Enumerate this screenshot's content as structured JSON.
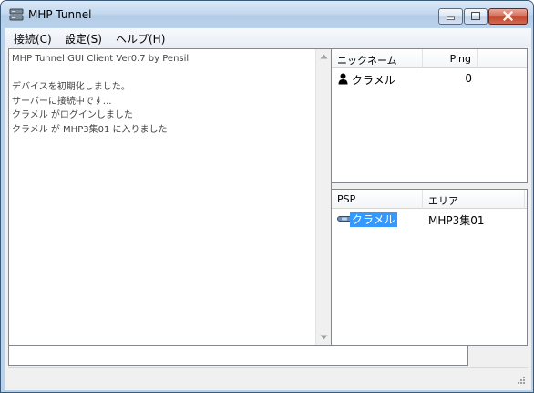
{
  "window": {
    "title": "MHP Tunnel",
    "icons": [
      "app-icon",
      "minimize-icon",
      "maximize-icon",
      "close-icon"
    ]
  },
  "menu": {
    "items": [
      "接続(C)",
      "設定(S)",
      "ヘルプ(H)"
    ]
  },
  "log": {
    "lines": [
      "MHP Tunnel GUI Client Ver0.7 by Pensil",
      "",
      "デバイスを初期化しました。",
      "サーバーに接続中です...",
      "クラメル がログインしました",
      "クラメル が MHP3集01 に入りました"
    ]
  },
  "users": {
    "columns": [
      "ニックネーム",
      "Ping"
    ],
    "rows": [
      {
        "icon": "user-icon",
        "nickname": "クラメル",
        "ping": "0"
      }
    ]
  },
  "psp": {
    "columns": [
      "PSP",
      "エリア"
    ],
    "rows": [
      {
        "icon": "psp-icon",
        "name": "クラメル",
        "area": "MHP3集01",
        "selected": true
      }
    ]
  },
  "input": {
    "value": ""
  },
  "colors": {
    "selection": "#3399ff",
    "frame": "#b9d1ea"
  }
}
